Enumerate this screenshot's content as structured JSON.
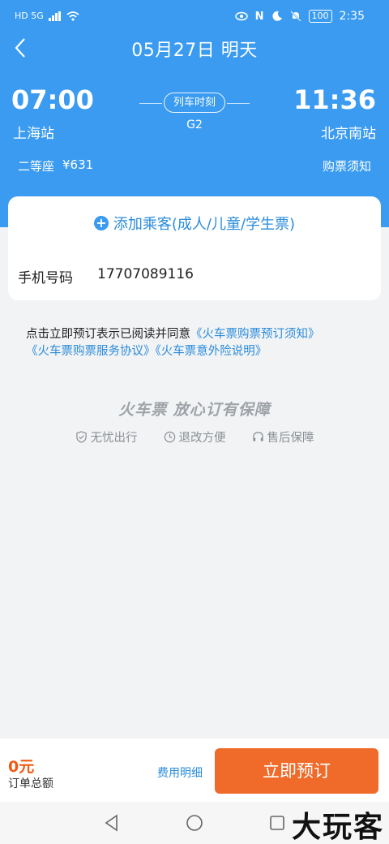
{
  "status_bar": {
    "left": "HD 5G",
    "time": "2:35",
    "battery": "100"
  },
  "header": {
    "title": "05月27日  明天",
    "depart_time": "07:00",
    "depart_station": "上海站",
    "arrive_time": "11:36",
    "arrive_station": "北京南站",
    "schedule_label": "列车时刻",
    "train_no": "G2",
    "seat_type": "二等座",
    "price": "¥631",
    "purchase_notice": "购票须知"
  },
  "card": {
    "add_passenger": "添加乘客(成人/儿童/学生票)",
    "phone_label": "手机号码",
    "phone_value": "17707089116"
  },
  "agreement": {
    "prefix": "点击立即预订表示已阅读并同意",
    "link1": "《火车票购票预订须知》",
    "link2": "《火车票购票服务协议》",
    "link3": "《火车票意外险说明》"
  },
  "promo": {
    "title": "火车票 放心订有保障",
    "items": [
      "无忧出行",
      "退改方便",
      "售后保障"
    ]
  },
  "bottom": {
    "total_amount": "0元",
    "total_label": "订单总额",
    "fee_detail": "费用明细",
    "book_button": "立即预订"
  },
  "watermark": "大玩客",
  "colors": {
    "header": "#3a9bf0",
    "link": "#2b8cdb",
    "accent": "#f06a2a",
    "price": "#ef5a14"
  }
}
